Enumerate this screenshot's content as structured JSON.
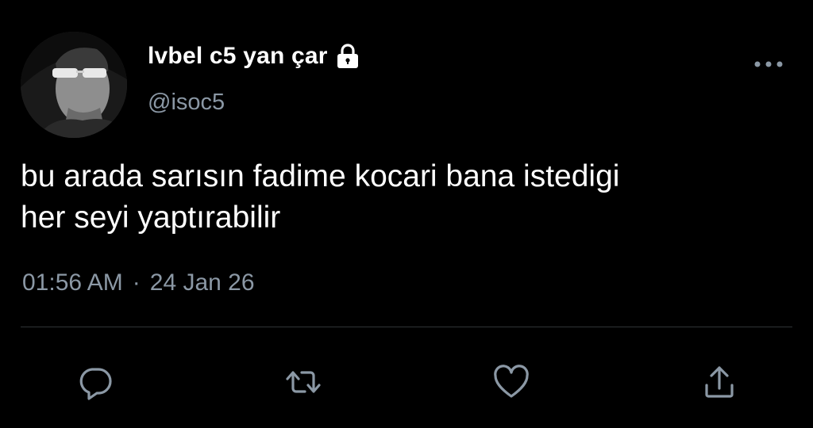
{
  "user": {
    "display_name": "lvbel c5 yan çar",
    "handle": "@isoc5",
    "protected_icon": "lock-icon"
  },
  "tweet": {
    "text": "bu arada sarısın fadime kocari bana istedigi\nher seyi yaptırabilir",
    "time": "01:56 AM",
    "separator": "·",
    "date": "24 Jan 26"
  },
  "actions": {
    "reply_icon": "reply-icon",
    "retweet_icon": "retweet-icon",
    "like_icon": "heart-icon",
    "share_icon": "share-icon",
    "more_icon": "more-icon"
  },
  "colors": {
    "background": "#000000",
    "text": "#ffffff",
    "secondary": "#8b98a5",
    "divider": "#2f3336"
  }
}
